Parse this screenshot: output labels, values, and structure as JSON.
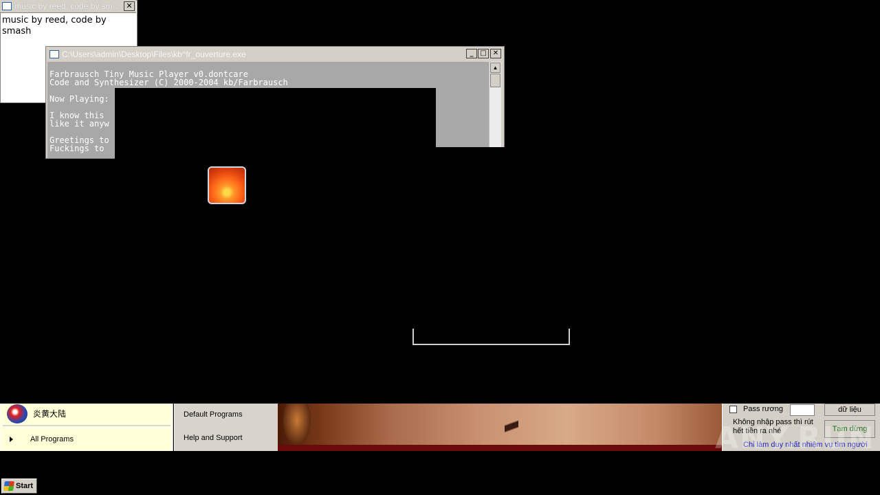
{
  "small_window": {
    "title": "music by reed, code by sm...",
    "body": "music by reed, code by smash",
    "close_glyph": "✕"
  },
  "console_window": {
    "title": "C:\\Users\\admin\\Desktop\\Files\\kb^fr_ouverture.exe",
    "minimize_glyph": "_",
    "maximize_glyph": "□",
    "close_glyph": "✕",
    "lines": [
      "Farbrausch Tiny Music Player v0.dontcare",
      "Code and Synthesizer (C) 2000-2004 kb/Farbrausch",
      "",
      "Now Playing:",
      "",
      "I know this",
      "like it anyw",
      "",
      "Greetings to",
      "Fuckings to"
    ]
  },
  "desktop_icon": {
    "name": "user-picture-flower-icon"
  },
  "start_menu": {
    "pinned_app": "炎黄大陆",
    "all_programs": "All Programs",
    "right_items": [
      "Default Programs",
      "Help and Support"
    ]
  },
  "control_panel": {
    "pass_checkbox_label": "Pass rương",
    "data_button": "dữ liệu",
    "note_line1": "Không nhập pass thì rút",
    "note_line2": "hết tiền ra nhé",
    "pause_button": "Tạm dừng",
    "link_text": "Chỉ làm duy nhất nhiệm vụ tìm người"
  },
  "watermark": "ANY.RUN",
  "taskbar": {
    "start_label": "Start"
  }
}
